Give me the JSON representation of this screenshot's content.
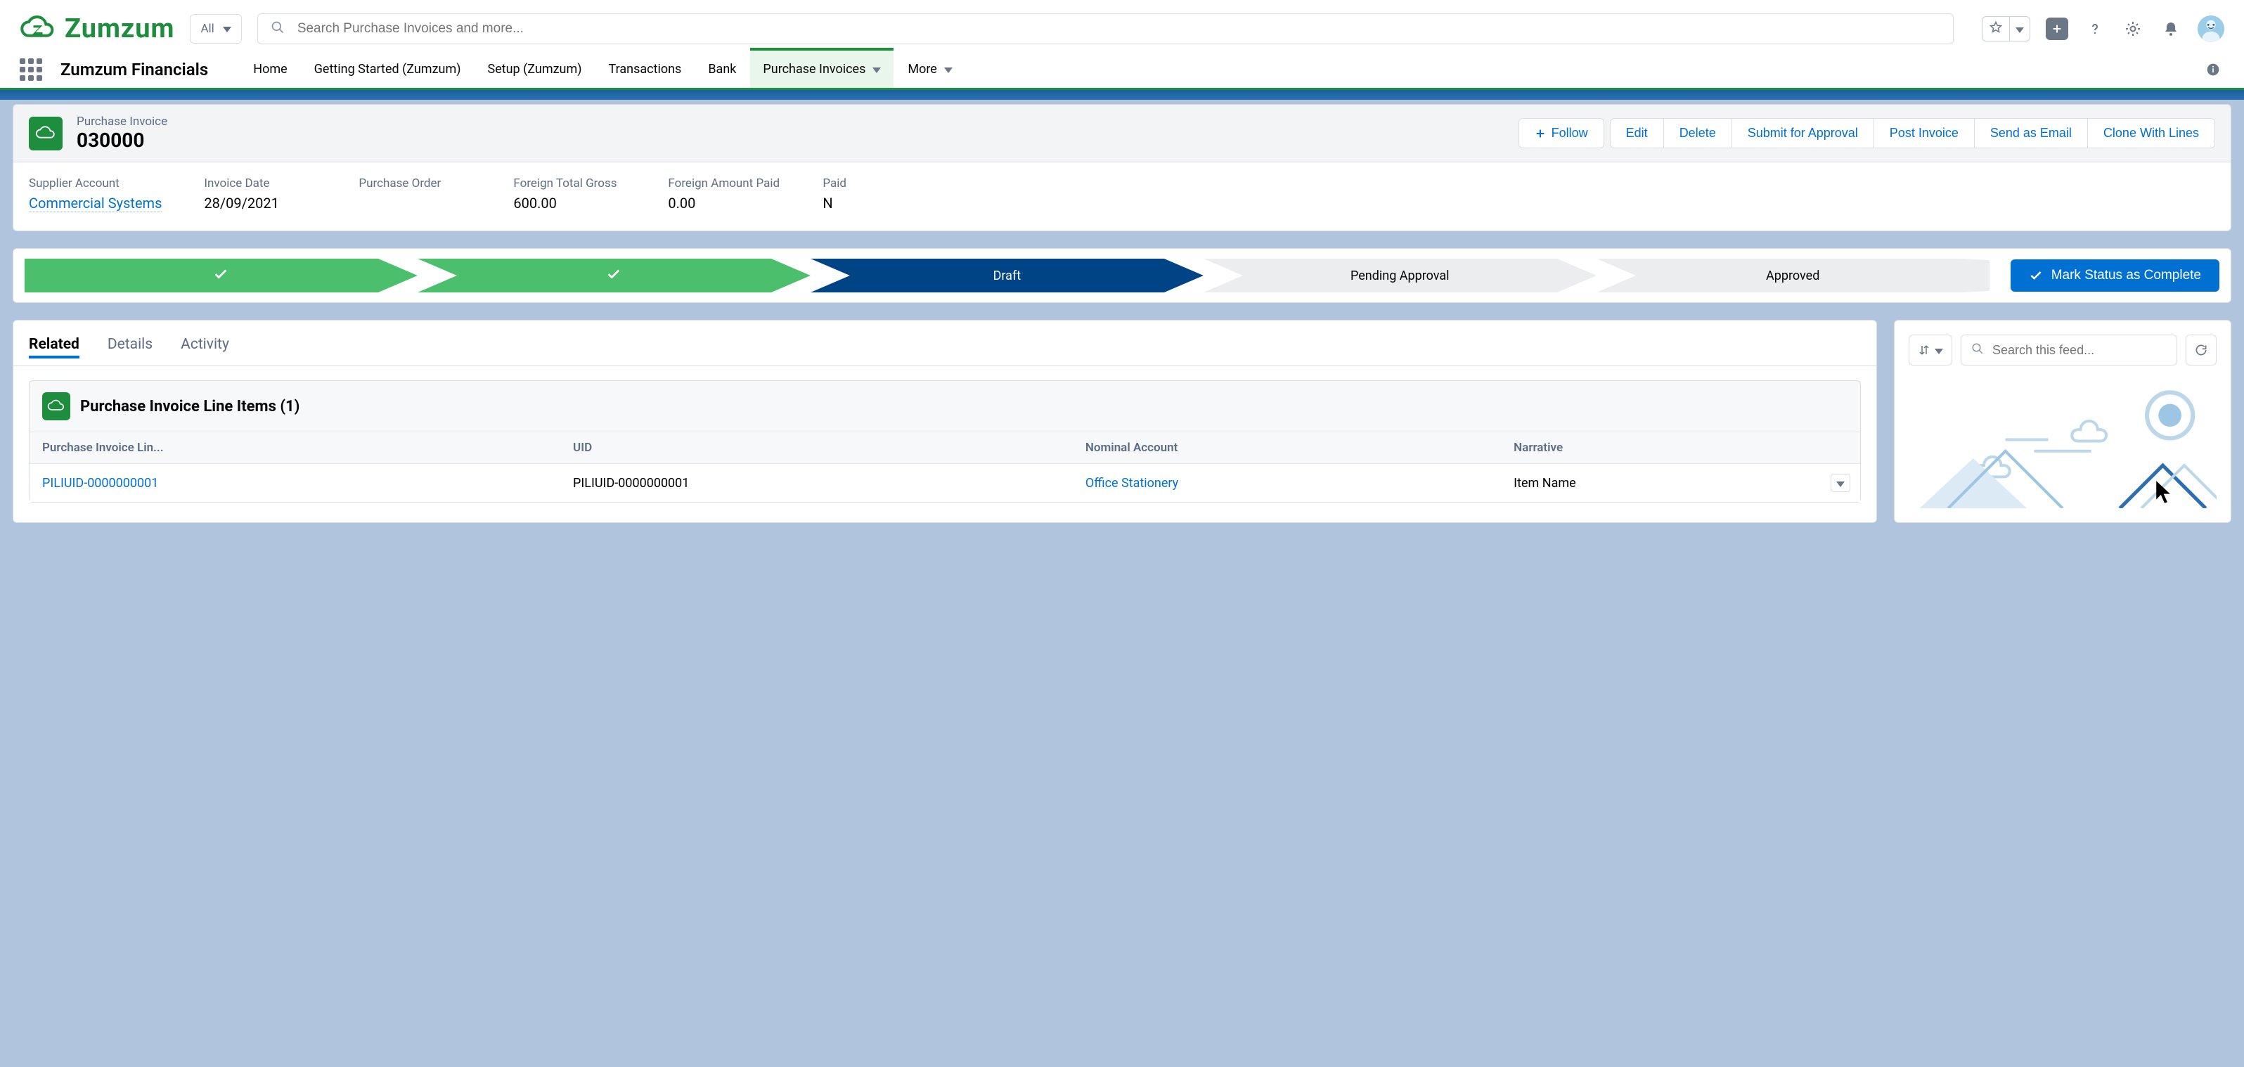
{
  "brand": {
    "name": "Zumzum"
  },
  "search": {
    "scope": "All",
    "placeholder": "Search Purchase Invoices and more..."
  },
  "nav": {
    "app": "Zumzum Financials",
    "items": [
      "Home",
      "Getting Started (Zumzum)",
      "Setup (Zumzum)",
      "Transactions",
      "Bank"
    ],
    "active": "Purchase Invoices",
    "more": "More"
  },
  "record": {
    "object": "Purchase Invoice",
    "name": "030000",
    "actions": {
      "follow": "Follow",
      "edit": "Edit",
      "delete": "Delete",
      "submit": "Submit for Approval",
      "post": "Post Invoice",
      "email": "Send as Email",
      "clone": "Clone With Lines"
    },
    "fields": {
      "supplier_label": "Supplier Account",
      "supplier_value": "Commercial Systems",
      "date_label": "Invoice Date",
      "date_value": "28/09/2021",
      "po_label": "Purchase Order",
      "po_value": "",
      "gross_label": "Foreign Total Gross",
      "gross_value": "600.00",
      "paid_amt_label": "Foreign Amount Paid",
      "paid_amt_value": "0.00",
      "paid_label": "Paid",
      "paid_value": "N"
    }
  },
  "path": {
    "stages": {
      "s3": "Draft",
      "s4": "Pending Approval",
      "s5": "Approved"
    },
    "complete": "Mark Status as Complete"
  },
  "tabs": {
    "related": "Related",
    "details": "Details",
    "activity": "Activity"
  },
  "related": {
    "title": "Purchase Invoice Line Items (1)",
    "cols": {
      "c1": "Purchase Invoice Lin...",
      "c2": "UID",
      "c3": "Nominal Account",
      "c4": "Narrative"
    },
    "row": {
      "link": "PILIUID-0000000001",
      "uid": "PILIUID-0000000001",
      "nominal": "Office Stationery",
      "narrative": "Item Name"
    }
  },
  "feed": {
    "placeholder": "Search this feed..."
  }
}
